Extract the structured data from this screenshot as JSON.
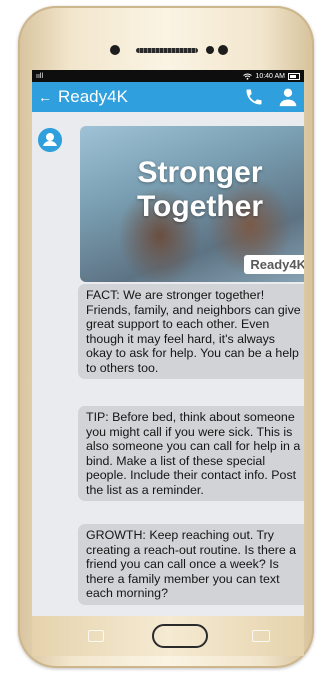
{
  "status_bar": {
    "signal": "ııll",
    "time": "10:40 AM"
  },
  "app_bar": {
    "back_icon": "back-arrow-icon",
    "title": "Ready4K",
    "call_icon": "phone-icon",
    "contact_icon": "person-icon"
  },
  "hero": {
    "title_line1": "Stronger",
    "title_line2": "Together",
    "badge": "Ready4K"
  },
  "messages": [
    {
      "text": "FACT: We are stronger together! Friends, family, and neighbors can give great support to each other. Even though it may feel hard, it's always okay to ask for help. You can be a help to others too."
    },
    {
      "text": "TIP: Before bed, think about someone you might call if you were sick. This is also someone you can call for help in a bind. Make a list of these special people. Include their contact info. Post the list as a reminder."
    },
    {
      "text": "GROWTH: Keep reaching out. Try creating a reach-out routine. Is there a friend you can call once a week? Is there a family member you can text each morning?"
    }
  ],
  "colors": {
    "app_bar": "#2f9fdd",
    "bubble": "#d2d3d6",
    "phone_body": "#f2e6cd"
  }
}
